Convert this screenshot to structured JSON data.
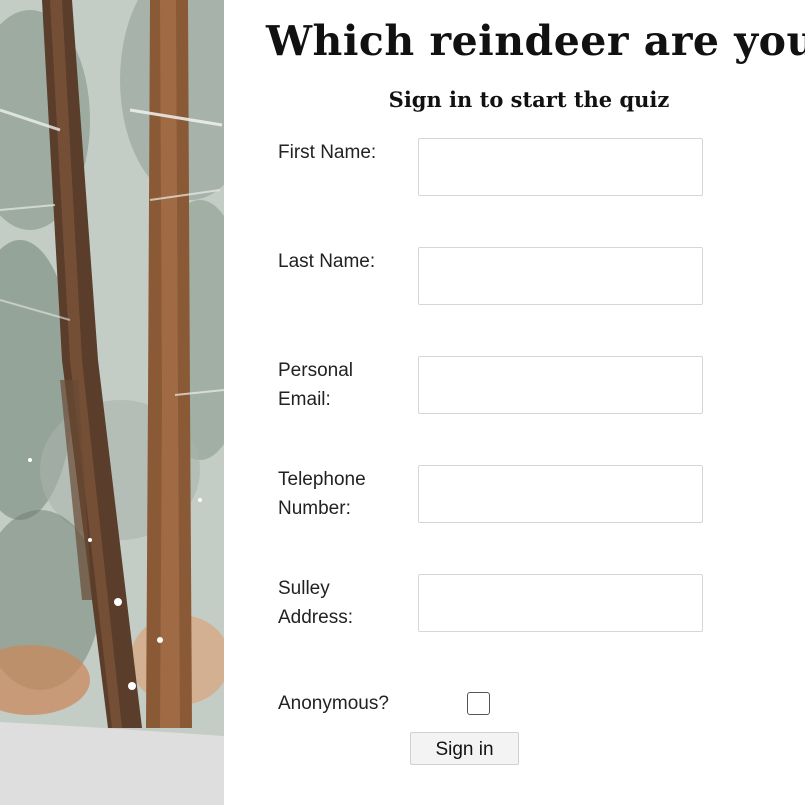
{
  "quiz": {
    "title": "Which reindeer are you?",
    "subtitle": "Sign in to start the quiz"
  },
  "form": {
    "fields": [
      {
        "label": "First Name:",
        "value": "",
        "placeholder": ""
      },
      {
        "label": "Last Name:",
        "value": "",
        "placeholder": ""
      },
      {
        "label": "Personal Email:",
        "value": "",
        "placeholder": ""
      },
      {
        "label": "Telephone Number:",
        "value": "",
        "placeholder": ""
      },
      {
        "label": "Sulley Address:",
        "value": "",
        "placeholder": ""
      }
    ],
    "anonymous_label": "Anonymous?",
    "anonymous_checked": false,
    "submit_label": "Sign in"
  }
}
